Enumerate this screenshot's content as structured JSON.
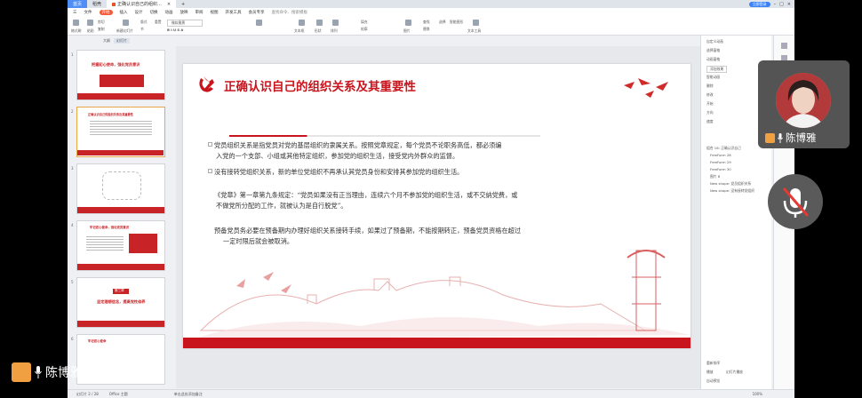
{
  "app": {
    "tabs": [
      "首页",
      "稻壳",
      "正确认识自己的组织...",
      "+"
    ],
    "login_label": "立即登录",
    "menu": [
      "三",
      "文件",
      "开始",
      "插入",
      "设计",
      "切换",
      "动画",
      "放映",
      "审阅",
      "视图",
      "开发工具",
      "会员专享",
      "查找命令、搜索模板"
    ],
    "menu_active": "开始",
    "ribbon": {
      "format_painter": "格式刷",
      "paste": "粘贴",
      "cut": "剪切",
      "copy": "复制",
      "new_slide": "新建幻灯片",
      "layout": "版式",
      "reset": "重置",
      "section": "节",
      "font": "微软雅黑",
      "text_box": "文本框",
      "shape": "形状",
      "arrange": "排列",
      "replace": "替换",
      "select": "选择",
      "picture": "图片",
      "fill": "填充",
      "outline": "轮廓",
      "find": "查找",
      "smart_graphic": "智能图形",
      "text_tool": "文本工具"
    },
    "sidebar_toggle": [
      "大纲",
      "幻灯片"
    ]
  },
  "thumbnails": [
    {
      "num": "1",
      "title": "把握初心使命，强化党员意识"
    },
    {
      "num": "2",
      "title": "正确认识自己的组织关系及其重要性"
    },
    {
      "num": "3",
      "title": ""
    },
    {
      "num": "4",
      "title": "牢记初心使命，强化党员意识"
    },
    {
      "num": "5",
      "title": "坚定理想信念，提高党性修养",
      "badge": "第三章"
    },
    {
      "num": "6",
      "title": "牢记初心使命"
    }
  ],
  "slide": {
    "title": "正确认识自己的组织关系及其重要性",
    "paragraphs": [
      [
        "党员组织关系是指党员对党的基层组织的隶属关系。按照党章规定，每个党员不论职务高低，都必须编",
        "入党的一个支部、小组或其他特定组织，参加党的组织生活，接受党内外群众的监督。"
      ],
      [
        "没有接转党组织关系，新的单位党组织不再承认其党员身份和安排其参加党的组织生活。"
      ],
      [
        "《党章》第一章第九条规定：“党员如果没有正当理由，连续六个月不参加党的组织生活，或不交纳党费，或",
        "不做党所分配的工作，就被认为是自行脱党”。"
      ],
      [
        "预备党员务必要在预备期内办理好组织关系接转手续，如果过了预备期，不能按期转正，预备党员资格在超过",
        "一定时限后就会被取消。"
      ]
    ]
  },
  "right_panel": {
    "title": "自定义动画",
    "items": [
      "选择窗格",
      "动画窗格",
      "添加效果",
      "智能动画",
      "删除",
      "修改",
      "开始",
      "方向",
      "速度",
      "组合 16: 正确认识自己",
      "FreeForm 28",
      "FreeForm 29",
      "FreeForm 30",
      "图片 8",
      "New shape: 党员组织关系",
      "New shape: 没有接转党组织",
      "重新排序",
      "播放",
      "幻灯片播放",
      "自动预览"
    ]
  },
  "status_bar": {
    "slide_indicator": "幻灯片 2 / 28",
    "theme": "Office 主题",
    "notes": "单击此处添加备注",
    "zoom": "100%"
  },
  "video_overlay": {
    "self_name": "陈博雅",
    "share_label": "陈博雅的屏幕共享"
  },
  "colors": {
    "accent_red": "#c8151d",
    "login_blue": "#3b82f6",
    "start_orange": "#f15a3a"
  }
}
